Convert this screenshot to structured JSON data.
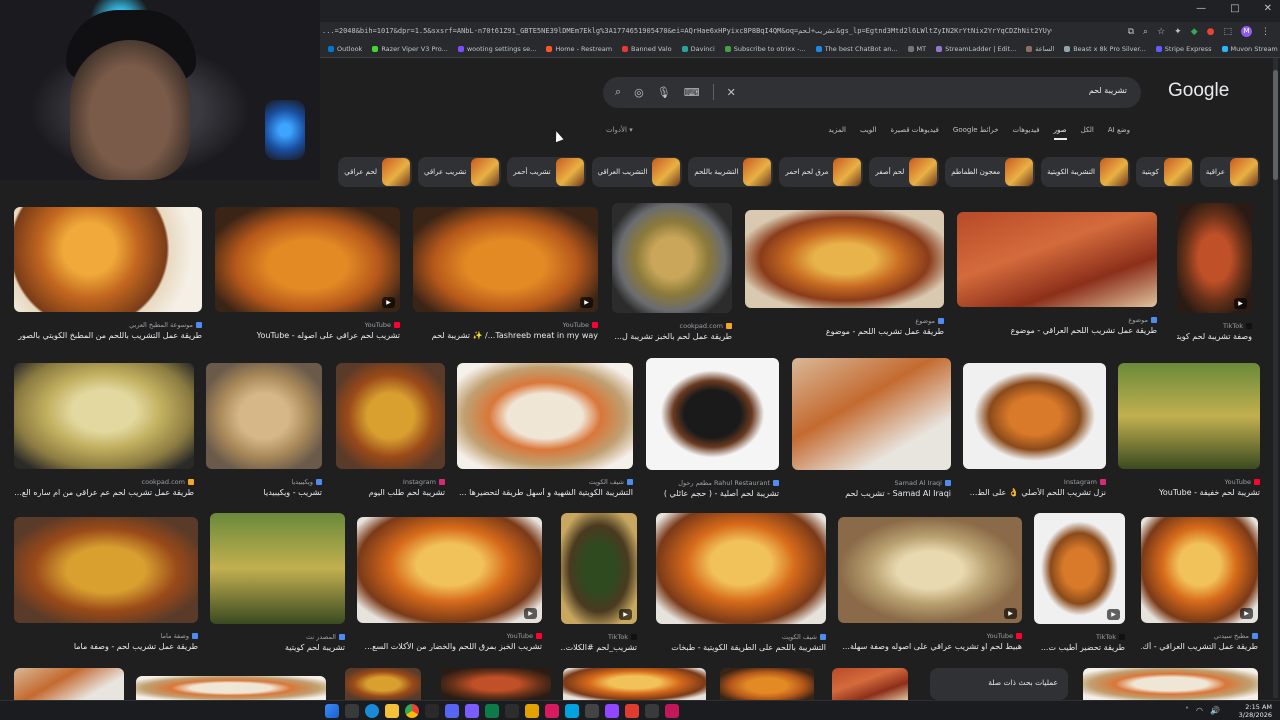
{
  "browser": {
    "url": "...=2048&bih=1017&dpr=1.5&sxsrf=ANbL-n70t61Z91_GBTE5NE39lDMEm7Eklg%3A1774651905470&ei=AQrHae6xHPyixc8P8BqI4QM&oq=تشريب+لحم&gs_lp=Egtnd3Mtd2l6LWltZyIN2KrYtNix2YrYqCDZhNit2YUyChAAGAcYHjIGEAAYBxgeMgYQABgH",
    "window_controls": [
      "—",
      "□",
      "✕"
    ],
    "profile_initial": "M",
    "bookmarks": [
      "Outlook",
      "Razer Viper V3 Pro...",
      "wooting settings se...",
      "Home - Restream",
      "Banned Valo",
      "Davinci",
      "Subscribe to otrixx -...",
      "The best ChatBot an...",
      "MT",
      "StreamLadder | Edit...",
      "الساعة",
      "Beast x 8k Pro Silver...",
      "Stripe Express",
      "Muvon Stream - Wa..."
    ]
  },
  "search": {
    "logo": "Google",
    "query": "تشريبة لحم",
    "tabs": [
      "وضع AI",
      "الكل",
      "صور",
      "فيديوهات",
      "خرائط Google",
      "فيديوهات قصيرة",
      "الويب",
      "المزيد"
    ],
    "active_tab": "صور",
    "tools_label": "الأدوات"
  },
  "chips": [
    "عراقية",
    "كويتية",
    "التشريبة الكويتية",
    "معجون الطماطم",
    "لحم أصفر",
    "مرق لحم احمر",
    "التشريبة باللحم",
    "التشريب العراقي",
    "تشريب أحمر",
    "تشريب عراقي",
    "لحم عراقي"
  ],
  "results": [
    {
      "source": "موسوعة المطبخ العربي",
      "title": "طريقة عمل التشريب باللحم من المطبخ الكويتي بالصور",
      "video": false
    },
    {
      "source": "YouTube",
      "title": "تشريب لحم عراقي على اصوله - YouTube",
      "video": true
    },
    {
      "source": "YouTube",
      "title": "Tashreeb meat in my way.../ ✨ تشريبة لحم",
      "video": true
    },
    {
      "source": "cookpad.com",
      "title": "طريقة عمل لحم بالخبز تشريبة ل...",
      "video": false
    },
    {
      "source": "موضوع",
      "title": "طريقة عمل تشريب اللحم - موضوع",
      "video": false
    },
    {
      "source": "موضوع",
      "title": "طريقة عمل تشريب اللحم العراقي - موضوع",
      "video": false
    },
    {
      "source": "TikTok",
      "title": "وصفة تشريبة لحم كويتي...",
      "video": true
    },
    {
      "source": "cookpad.com",
      "title": "طريقة عمل تشريب لحم عم عراقي من ام ساره الع...",
      "video": false
    },
    {
      "source": "ويكيبيديا",
      "title": "تشريب - ويكيبيديا",
      "video": false
    },
    {
      "source": "Instagram",
      "title": "تشريبة لحم طلب اليوم",
      "video": false
    },
    {
      "source": "شيف الكويت",
      "title": "التشريبة الكويتية الشهية و أسهل طريقة لتحضيرها ...",
      "video": false
    },
    {
      "source": "Rahul Restaurant مطعم رحول",
      "title": "تشريبة لحم أصلية - ( حجم عائلي )",
      "video": false
    },
    {
      "source": "Samad Al Iraqi",
      "title": "Samad Al Iraqi - تشريب لحم",
      "video": false
    },
    {
      "source": "Instagram",
      "title": "نزل تشريب اللحم الأصلي 👌 على الط...",
      "video": false
    },
    {
      "source": "YouTube",
      "title": "تشريبة لحم خفيفة - YouTube",
      "video": false
    },
    {
      "source": "وصفة ماما",
      "title": "طريقة عمل تشريب لحم - وصفة ماما",
      "video": false
    },
    {
      "source": "المصدر نت",
      "title": "تشريبة لحم كويتية",
      "video": false
    },
    {
      "source": "YouTube",
      "title": "تشريب الخبز بمرق اللحم والخضار من الأكلات السع...",
      "video": true
    },
    {
      "source": "TikTok",
      "title": "تشريب_لحم #الكلات...",
      "video": true
    },
    {
      "source": "شيف الكويت",
      "title": "التشريبة باللحم على الطريقة الكويتية - طبخات",
      "video": false
    },
    {
      "source": "YouTube",
      "title": "هبيط لحم او تشريب عراقي على اصوله وصفة سهلة...",
      "video": true
    },
    {
      "source": "TikTok",
      "title": "طريقة تحضير أطيب ت...",
      "video": true
    },
    {
      "source": "مطبخ سيدتي",
      "title": "طريقة عمل التشريب العراقي - أك...",
      "video": true
    }
  ],
  "related": "عمليات بحث ذات صلة",
  "taskbar": {
    "time": "2:15 AM",
    "date": "3/28/2026"
  }
}
